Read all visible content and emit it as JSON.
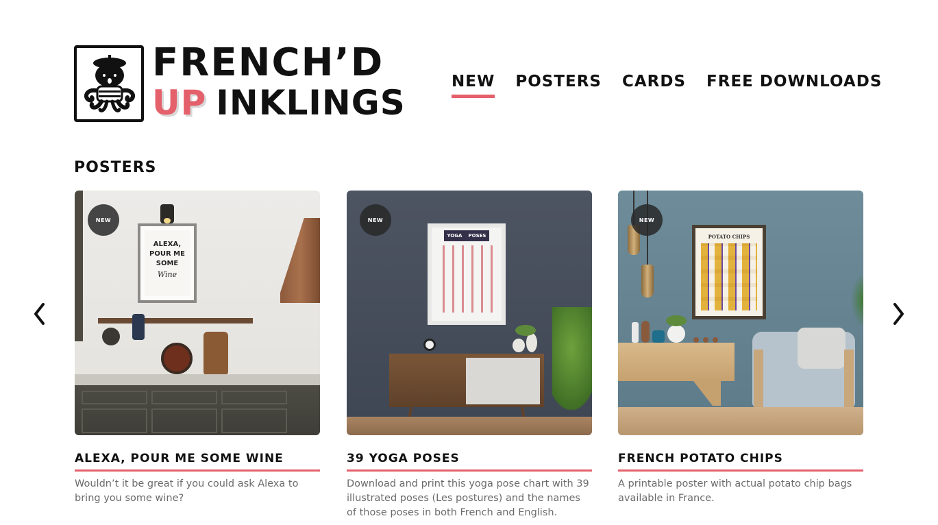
{
  "brand": {
    "line1": "FRENCH’D",
    "line2_accent": "UP",
    "line2_rest": "INKLINGS"
  },
  "nav": {
    "items": [
      {
        "label": "NEW",
        "active": true
      },
      {
        "label": "POSTERS",
        "active": false
      },
      {
        "label": "CARDS",
        "active": false
      },
      {
        "label": "FREE DOWNLOADS",
        "active": false
      }
    ]
  },
  "section": {
    "title": "POSTERS"
  },
  "carousel": {
    "prev_icon": "chevron-left-icon",
    "next_icon": "chevron-right-icon",
    "cards": [
      {
        "badge": "NEW",
        "title": "ALEXA, POUR ME SOME WINE",
        "description": "Wouldn’t it be great if you could ask Alexa to bring you some wine?",
        "poster_text": [
          "ALEXA,",
          "POUR ME",
          "SOME",
          "Wine"
        ]
      },
      {
        "badge": "NEW",
        "title": "39 YOGA POSES",
        "description": "Download and print this yoga pose chart with 39 illustrated poses (Les postures) and the names of those poses in both French and English.",
        "poster_text": [
          "YOGA",
          "POSES"
        ]
      },
      {
        "badge": "NEW",
        "title": "FRENCH POTATO CHIPS",
        "description": "A printable poster with actual potato chip bags available in France.",
        "poster_text": [
          "POTATO CHIPS"
        ]
      }
    ]
  },
  "colors": {
    "accent": "#e4606a",
    "text": "#111111",
    "muted": "#6b6b6b"
  }
}
